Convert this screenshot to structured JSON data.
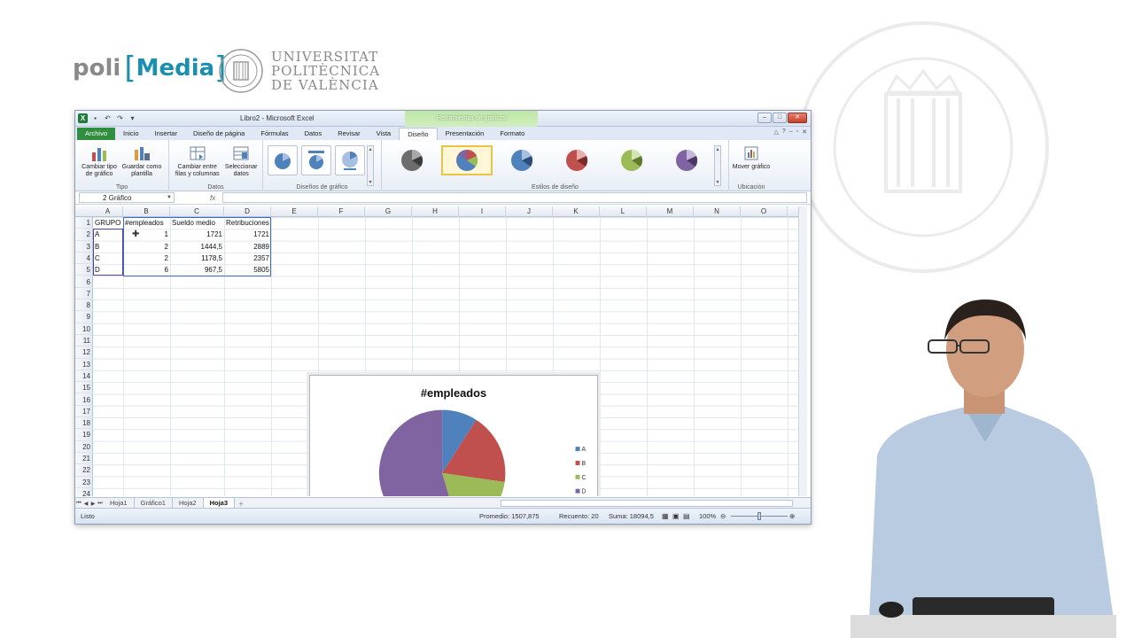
{
  "brand": {
    "poli": "poli",
    "media": "Media",
    "bracket_left": "[",
    "bracket_right": "]"
  },
  "university": {
    "line1": "UNIVERSITAT",
    "line2": "POLITÈCNICA",
    "line3": "DE VALÈNCIA"
  },
  "window": {
    "title": "Libro2 - Microsoft Excel",
    "context_tab": "Herramientas de gráficos"
  },
  "tabs": [
    {
      "label": "Archivo"
    },
    {
      "label": "Inicio"
    },
    {
      "label": "Insertar"
    },
    {
      "label": "Diseño de página"
    },
    {
      "label": "Fórmulas"
    },
    {
      "label": "Datos"
    },
    {
      "label": "Revisar"
    },
    {
      "label": "Vista"
    },
    {
      "label": "Diseño"
    },
    {
      "label": "Presentación"
    },
    {
      "label": "Formato"
    }
  ],
  "ribbon": {
    "change_type": "Cambiar tipo de gráfico",
    "save_template": "Guardar como plantilla",
    "group_tipo": "Tipo",
    "switch_rows": "Cambiar entre filas y columnas",
    "select_data": "Seleccionar datos",
    "group_datos": "Datos",
    "group_layouts": "Diseños de gráfico",
    "group_styles": "Estilos de diseño",
    "move_chart": "Mover gráfico",
    "group_location": "Ubicación",
    "style_colors": [
      "#6d6d6d",
      "#4f81bd",
      "#4f81bd",
      "#c0504d",
      "#9bbb59",
      "#8064a2"
    ]
  },
  "formula_bar": {
    "name_box": "2 Gráfico",
    "fx": "fx"
  },
  "columns": [
    "A",
    "B",
    "C",
    "D",
    "E",
    "F",
    "G",
    "H",
    "I",
    "J",
    "K",
    "L",
    "M",
    "N",
    "O"
  ],
  "rows": [
    "1",
    "2",
    "3",
    "4",
    "5",
    "6",
    "7",
    "8",
    "9",
    "10",
    "11",
    "12",
    "13",
    "14",
    "15",
    "16",
    "17",
    "18",
    "19",
    "20",
    "21",
    "22",
    "23",
    "24"
  ],
  "table": {
    "headers": [
      "GRUPO",
      "#empleados",
      "Sueldo medio",
      "Retribuciones"
    ],
    "rows": [
      [
        "A",
        "1",
        "1721",
        "1721"
      ],
      [
        "B",
        "2",
        "1444,5",
        "2889"
      ],
      [
        "C",
        "2",
        "1178,5",
        "2357"
      ],
      [
        "D",
        "6",
        "967,5",
        "5805"
      ]
    ]
  },
  "chart_data": {
    "type": "pie",
    "title": "#empleados",
    "categories": [
      "A",
      "B",
      "C",
      "D"
    ],
    "values": [
      1,
      2,
      2,
      6
    ],
    "colors": [
      "#4f81bd",
      "#c0504d",
      "#9bbb59",
      "#8064a2"
    ],
    "legend_position": "right"
  },
  "sheets": [
    {
      "label": "Hoja1"
    },
    {
      "label": "Gráfico1"
    },
    {
      "label": "Hoja2"
    },
    {
      "label": "Hoja3"
    }
  ],
  "status": {
    "mode": "Listo",
    "average": "Promedio: 1507,875",
    "count": "Recuento: 20",
    "sum": "Suma: 18094,5",
    "zoom": "100%"
  }
}
